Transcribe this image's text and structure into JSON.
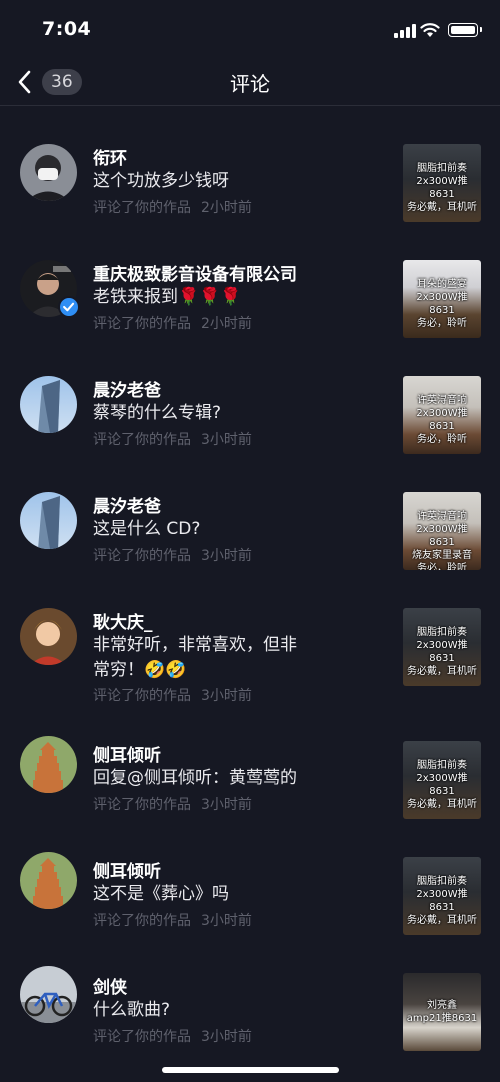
{
  "status": {
    "time": "7:04"
  },
  "header": {
    "back_count": "36",
    "title": "评论"
  },
  "comments": [
    {
      "username": "衔环",
      "text": "这个功放多少钱呀",
      "meta": "评论了你的作品",
      "time": "2小时前",
      "thumb_text": "胭脂扣前奏\n2x300W推8631\n务必戴，耳机听"
    },
    {
      "username": "重庆极致影音设备有限公司",
      "text": "老铁来报到🌹🌹🌹",
      "meta": "评论了你的作品",
      "time": "2小时前",
      "thumb_text": "耳朵的盛宴\n2x300W推8631\n务必，聆听"
    },
    {
      "username": "晨汐老爸",
      "text": "蔡琴的什么专辑?",
      "meta": "评论了你的作品",
      "time": "3小时前",
      "thumb_text": "许英浔音响\n2x300W推8631\n务必，聆听"
    },
    {
      "username": "晨汐老爸",
      "text": "这是什么 CD?",
      "meta": "评论了你的作品",
      "time": "3小时前",
      "thumb_text": "许英浔音响\n2x300W推8631\n烧友家里录音\n务必，聆听"
    },
    {
      "username": "耿大庆_",
      "text": "非常好听，非常喜欢，但非常穷！🤣🤣",
      "meta": "评论了你的作品",
      "time": "3小时前",
      "thumb_text": "胭脂扣前奏\n2x300W推8631\n务必戴，耳机听"
    },
    {
      "username": "侧耳倾听",
      "text": "回复@侧耳倾听：黄莺莺的",
      "meta": "评论了你的作品",
      "time": "3小时前",
      "thumb_text": "胭脂扣前奏\n2x300W推8631\n务必戴，耳机听"
    },
    {
      "username": "侧耳倾听",
      "text": "这不是《葬心》吗",
      "meta": "评论了你的作品",
      "time": "3小时前",
      "thumb_text": "胭脂扣前奏\n2x300W推8631\n务必戴，耳机听"
    },
    {
      "username": "剑侠",
      "text": "什么歌曲?",
      "meta": "评论了你的作品",
      "time": "3小时前",
      "thumb_text": "刘亮鑫\namp21推8631"
    }
  ],
  "colors": {
    "background": "#161823",
    "meta": "#5f616d",
    "verified": "#2f8ef4"
  }
}
